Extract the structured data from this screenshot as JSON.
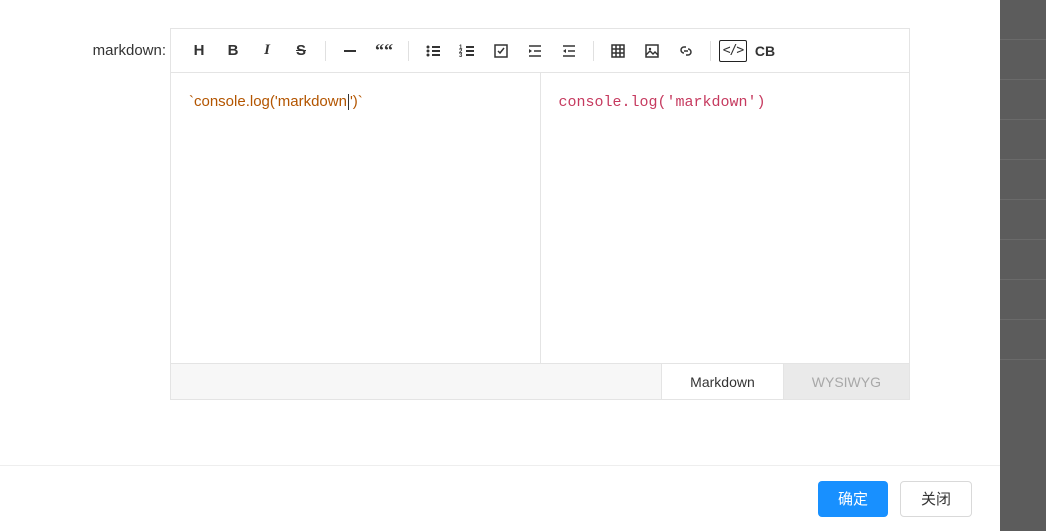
{
  "form": {
    "label": "markdown:"
  },
  "toolbar": {
    "h": "H",
    "b": "B",
    "i": "I",
    "s": "S",
    "quote": "““",
    "code": "</>",
    "cb": "CB"
  },
  "editor": {
    "source_before": "`console.log('markdown",
    "source_after": "')`",
    "preview": "console.log('markdown')"
  },
  "tabs": {
    "markdown": "Markdown",
    "wysiwyg": "WYSIWYG"
  },
  "footer": {
    "ok": "确定",
    "close": "关闭"
  }
}
